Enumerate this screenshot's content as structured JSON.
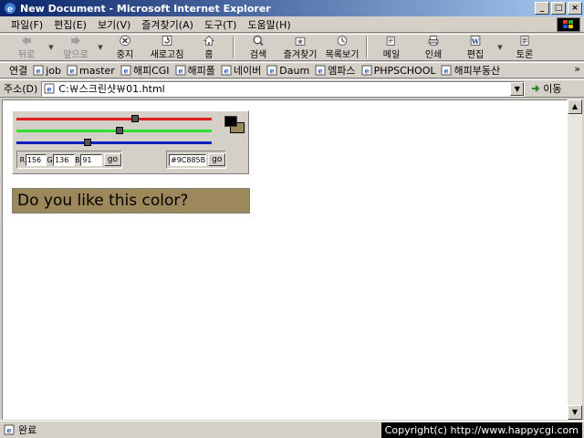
{
  "window": {
    "title": "New Document - Microsoft Internet Explorer",
    "minimize": "_",
    "maximize": "□",
    "close": "×"
  },
  "menu": [
    "파일(F)",
    "편집(E)",
    "보기(V)",
    "즐겨찾기(A)",
    "도구(T)",
    "도움말(H)"
  ],
  "toolbar": {
    "back": "뒤로",
    "forward": "앞으로",
    "stop": "중지",
    "refresh": "새로고침",
    "home": "홈",
    "search": "검색",
    "favorites": "즐겨찾기",
    "history": "목록보기",
    "mail": "메일",
    "print": "인쇄",
    "edit": "편집",
    "discuss": "토론"
  },
  "links": {
    "label": "연결",
    "items": [
      "job",
      "master",
      "해피CGI",
      "해피폴",
      "네이버",
      "Daum",
      "엠파스",
      "PHPSCHOOL",
      "해피부동산"
    ],
    "more": "»"
  },
  "address": {
    "label": "주소(D)",
    "value": "C:￦스크린샷￦01.html",
    "go_label": "이동"
  },
  "status": {
    "text": "완료",
    "copyright": "Copyright(c) http://www.happycgi.com"
  },
  "picker": {
    "r_label": "R",
    "g_label": "G",
    "b_label": "B",
    "r_value": "156",
    "g_value": "136",
    "b_value": "91",
    "go_label": "go",
    "hex_value": "#9C885B",
    "hex_go_label": "go",
    "red_level": 0.61,
    "green_level": 0.53,
    "blue_level": 0.36,
    "red_color": "#e02020",
    "green_color": "#30e030",
    "blue_color": "#1020c0",
    "selected_color": "#9c885b"
  },
  "preview": {
    "text": "Do you like this color?",
    "background": "#9c885b"
  }
}
